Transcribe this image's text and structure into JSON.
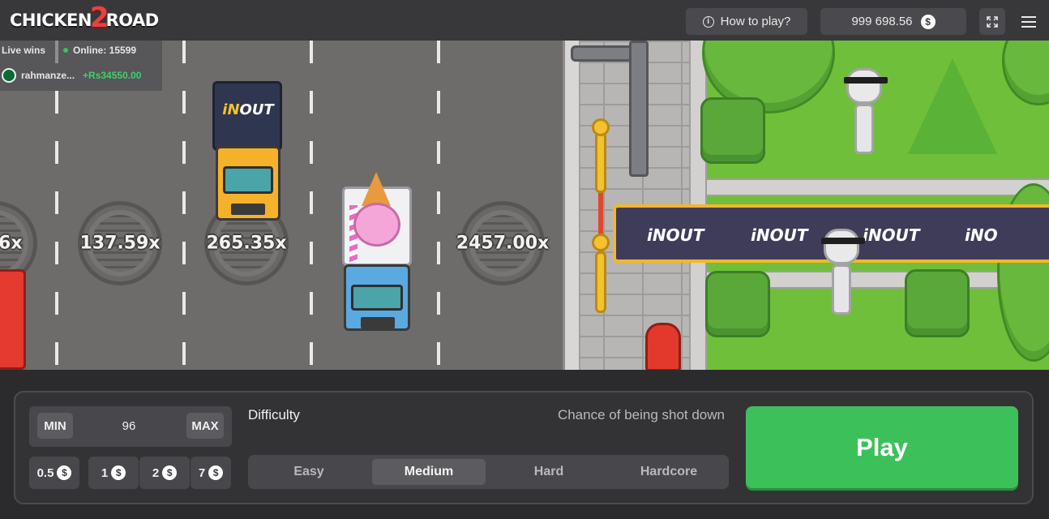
{
  "header": {
    "logo_part1": "CHICKEN",
    "logo_part2": "2",
    "logo_part3": "ROAD",
    "how_to_play_label": "How to play?",
    "balance": "999 698.56",
    "currency_symbol": "$"
  },
  "live_wins": {
    "title": "Live wins",
    "online_label": "Online: 15599",
    "winner_name": "rahmanze...",
    "winner_amount": "+Rs34550.00"
  },
  "game": {
    "multipliers": [
      "6x",
      "137.59x",
      "265.35x",
      "2457.00x"
    ],
    "truck_brand_prefix": "iN",
    "truck_brand_suffix": "OUT",
    "banner_items": [
      "iNOUT",
      "iNOUT",
      "iNOUT",
      "iNO"
    ]
  },
  "controls": {
    "min_label": "MIN",
    "max_label": "MAX",
    "bet_value": "96",
    "quick_bets": [
      "0.5",
      "1",
      "2",
      "7"
    ],
    "currency_symbol": "$",
    "difficulty_label": "Difficulty",
    "chance_label": "Chance of being shot down",
    "difficulties": [
      "Easy",
      "Medium",
      "Hard",
      "Hardcore"
    ],
    "selected_difficulty": "Medium",
    "play_label": "Play"
  },
  "colors": {
    "play_green": "#3cc15a",
    "background": "#2b2b2d",
    "panel": "#333336",
    "accent_yellow": "#f5c12e"
  }
}
